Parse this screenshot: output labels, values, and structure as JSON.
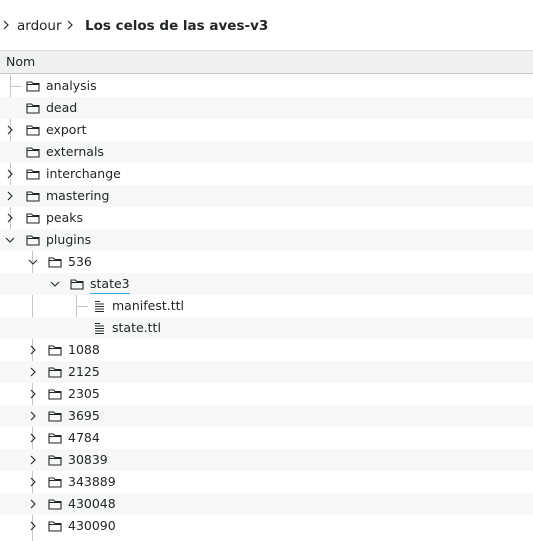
{
  "breadcrumb": {
    "root": "ardour",
    "current": "Los celos de las aves-v3"
  },
  "columns": {
    "name": "Nom"
  },
  "tree": {
    "top": [
      {
        "label": "analysis",
        "type": "folder",
        "expander": "none"
      },
      {
        "label": "dead",
        "type": "folder",
        "expander": "none"
      },
      {
        "label": "export",
        "type": "folder",
        "expander": "collapsed"
      },
      {
        "label": "externals",
        "type": "folder",
        "expander": "none"
      },
      {
        "label": "interchange",
        "type": "folder",
        "expander": "collapsed"
      },
      {
        "label": "mastering",
        "type": "folder",
        "expander": "collapsed"
      },
      {
        "label": "peaks",
        "type": "folder",
        "expander": "collapsed"
      },
      {
        "label": "plugins",
        "type": "folder",
        "expander": "expanded"
      }
    ],
    "plugins_children": [
      {
        "label": "536",
        "type": "folder",
        "expander": "expanded"
      },
      {
        "label": "1088",
        "type": "folder",
        "expander": "collapsed"
      },
      {
        "label": "2125",
        "type": "folder",
        "expander": "collapsed"
      },
      {
        "label": "2305",
        "type": "folder",
        "expander": "collapsed"
      },
      {
        "label": "3695",
        "type": "folder",
        "expander": "collapsed"
      },
      {
        "label": "4784",
        "type": "folder",
        "expander": "collapsed"
      },
      {
        "label": "30839",
        "type": "folder",
        "expander": "collapsed"
      },
      {
        "label": "343889",
        "type": "folder",
        "expander": "collapsed"
      },
      {
        "label": "430048",
        "type": "folder",
        "expander": "collapsed"
      },
      {
        "label": "430090",
        "type": "folder",
        "expander": "collapsed"
      }
    ],
    "f536_children": [
      {
        "label": "state3",
        "type": "folder",
        "expander": "expanded"
      }
    ],
    "state3_children": [
      {
        "label": "manifest.ttl",
        "type": "file"
      },
      {
        "label": "state.ttl",
        "type": "file"
      }
    ]
  },
  "icons": {
    "breadcrumb_separator": "chevron-right-icon",
    "folder": "folder-icon",
    "file": "text-file-icon",
    "expanded": "chevron-down-icon",
    "collapsed": "chevron-right-icon"
  },
  "colors": {
    "selection_underline": "#3daee9",
    "text": "#232627",
    "header_bg": "#eff0f1"
  }
}
